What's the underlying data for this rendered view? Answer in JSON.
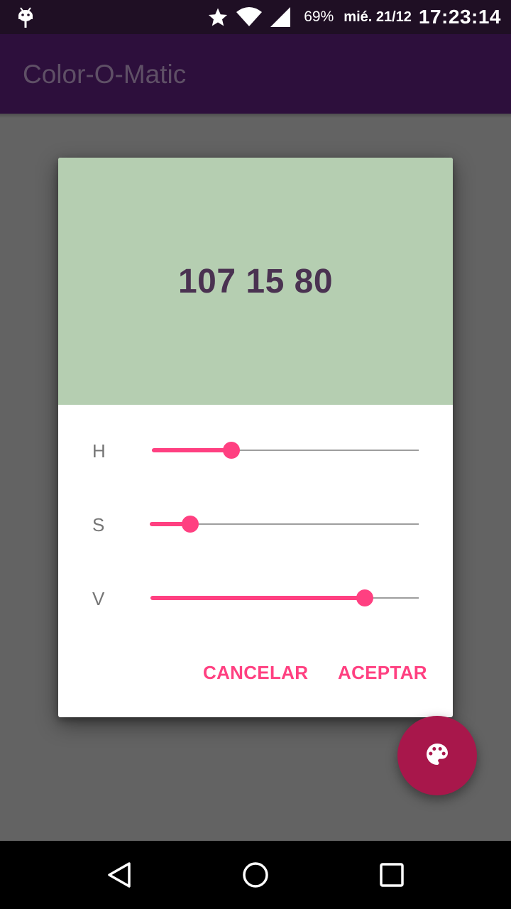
{
  "status_bar": {
    "battery_percent": "69%",
    "date": "mié. 21/12",
    "time": "17:23:14",
    "icons": [
      "android-debug-icon",
      "star-icon",
      "wifi-icon",
      "signal-icon"
    ]
  },
  "app_bar": {
    "title": "Color-O-Matic"
  },
  "dialog": {
    "preview_color": "#b5ceb1",
    "preview_text": "107 15 80",
    "sliders": [
      {
        "label": "H",
        "value": 107,
        "max": 360,
        "fraction": 0.297
      },
      {
        "label": "S",
        "value": 15,
        "max": 100,
        "fraction": 0.15
      },
      {
        "label": "V",
        "value": 80,
        "max": 100,
        "fraction": 0.8
      }
    ],
    "cancel_label": "CANCELAR",
    "accept_label": "ACEPTAR"
  },
  "fab": {
    "icon": "palette-icon",
    "color": "#a8174b"
  },
  "colors": {
    "accent": "#ff4081",
    "primary_dark": "#2d0f3c",
    "scrim": "#636363"
  },
  "nav_bar": {
    "buttons": [
      "back-icon",
      "home-icon",
      "recents-icon"
    ]
  }
}
